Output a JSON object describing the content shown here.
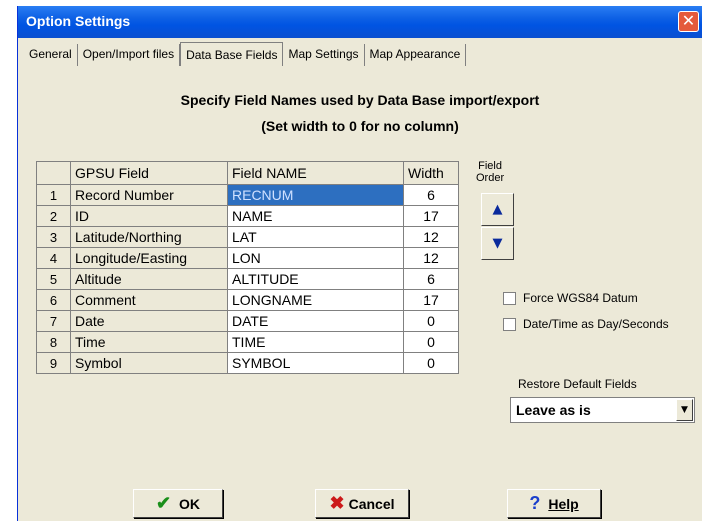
{
  "window": {
    "title": "Option Settings",
    "close_glyph": "✕"
  },
  "tabs": [
    {
      "label": "General"
    },
    {
      "label": "Open/Import files"
    },
    {
      "label": "Data Base Fields",
      "active": true
    },
    {
      "label": "Map Settings"
    },
    {
      "label": "Map Appearance"
    }
  ],
  "heading": {
    "line1": "Specify Field Names used by Data Base import/export",
    "line2": "(Set width to 0 for no column)"
  },
  "table": {
    "headers": [
      "",
      "GPSU Field",
      "Field NAME",
      "Width"
    ],
    "rows": [
      {
        "n": "1",
        "gpsu": "Record Number",
        "name": "RECNUM",
        "width": "6"
      },
      {
        "n": "2",
        "gpsu": "ID",
        "name": "NAME",
        "width": "17"
      },
      {
        "n": "3",
        "gpsu": "Latitude/Northing",
        "name": "LAT",
        "width": "12"
      },
      {
        "n": "4",
        "gpsu": "Longitude/Easting",
        "name": "LON",
        "width": "12"
      },
      {
        "n": "5",
        "gpsu": "Altitude",
        "name": "ALTITUDE",
        "width": "6"
      },
      {
        "n": "6",
        "gpsu": "Comment",
        "name": "LONGNAME",
        "width": "17"
      },
      {
        "n": "7",
        "gpsu": "Date",
        "name": "DATE",
        "width": "0"
      },
      {
        "n": "8",
        "gpsu": "Time",
        "name": "TIME",
        "width": "0"
      },
      {
        "n": "9",
        "gpsu": "Symbol",
        "name": "SYMBOL",
        "width": "0"
      }
    ],
    "selected_cell": "RECNUM"
  },
  "field_order": {
    "label_line1": "Field",
    "label_line2": "Order",
    "up_icon": "arrow-up-icon",
    "down_icon": "arrow-down-icon"
  },
  "options": {
    "force_wgs84": "Force WGS84 Datum",
    "date_time_seconds": "Date/Time as Day/Seconds"
  },
  "restore": {
    "label": "Restore Default Fields",
    "selected": "Leave as is"
  },
  "buttons": {
    "ok": "OK",
    "cancel": "Cancel",
    "help": "Help"
  },
  "colors": {
    "titlebar": "#0054e3",
    "selection": "#2d6fc0",
    "dialog_bg": "#ece9d8"
  }
}
